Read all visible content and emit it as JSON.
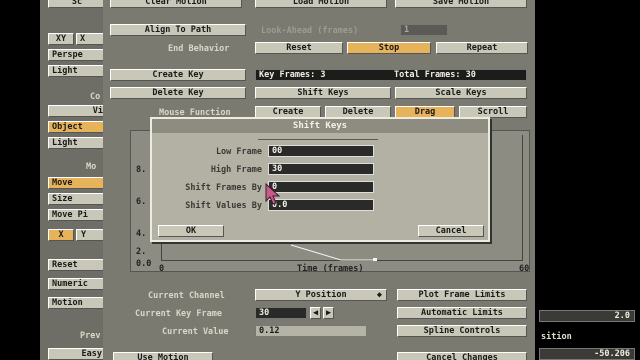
{
  "top_buttons": {
    "clear_motion": "Clear Motion",
    "load_motion": "Load Motion",
    "save_motion": "Save Motion"
  },
  "path": {
    "align_to_path": "Align To Path",
    "look_ahead_label": "Look-Ahead (frames)",
    "look_ahead_value": "1",
    "end_behavior_label": "End Behavior",
    "end_behavior_options": [
      "Reset",
      "Stop",
      "Repeat"
    ],
    "end_behavior_selected": "Stop"
  },
  "keys": {
    "create_key": "Create Key",
    "delete_key": "Delete Key",
    "key_frames_label": "Key Frames: 3",
    "total_frames_label": "Total Frames: 30",
    "shift_keys": "Shift Keys",
    "scale_keys": "Scale Keys"
  },
  "mouse_function": {
    "label": "Mouse Function",
    "options": [
      "Create",
      "Delete",
      "Drag",
      "Scroll"
    ],
    "selected": "Drag"
  },
  "left_panel": {
    "top_partial": "Sc",
    "axis_buttons": [
      "XY",
      "X"
    ],
    "persp": "Perspe",
    "light_top": "Light",
    "section_label_1": "Co",
    "view_partial": "Vi",
    "object": "Object",
    "light": "Light",
    "section_label_2": "Mo",
    "move": "Move",
    "size": "Size",
    "move_pivot": "Move Pi",
    "axis_x": "X",
    "axis_y": "Y",
    "reset": "Reset",
    "numeric": "Numeric",
    "motion": "Motion",
    "prev": "Prev",
    "easy": "Easy"
  },
  "graph": {
    "y_ticks": [
      "8.",
      "6.",
      "4.",
      "2.",
      "0.0"
    ],
    "x_ticks": [
      "0",
      "60"
    ],
    "xlabel": "Time (frames)"
  },
  "dialog": {
    "title": "Shift Keys",
    "low_frame_label": "Low Frame",
    "low_frame_value": "00",
    "high_frame_label": "High Frame",
    "high_frame_value": "30",
    "shift_frames_label": "Shift Frames By",
    "shift_frames_value": "0",
    "shift_values_label": "Shift Values By",
    "shift_values_value": "0.0",
    "ok": "OK",
    "cancel": "Cancel"
  },
  "channel": {
    "current_channel_label": "Current Channel",
    "current_channel_value": "Y Position",
    "current_key_frame_label": "Current Key Frame",
    "current_key_frame_value": "30",
    "current_value_label": "Current Value",
    "current_value_value": "0.12",
    "plot_frame_limits": "Plot Frame Limits",
    "automatic_limits": "Automatic Limits",
    "spline_controls": "Spline Controls",
    "use_motion": "Use Motion",
    "cancel_changes": "Cancel Changes"
  },
  "right_strip": {
    "value_top": "2.0",
    "position_label": "sition",
    "value_bottom": "-50.206"
  },
  "colors": {
    "panel": "#7a7a70",
    "button": "#c9c7b8",
    "highlight": "#e6b35a",
    "dialog": "#b3b1a3"
  }
}
